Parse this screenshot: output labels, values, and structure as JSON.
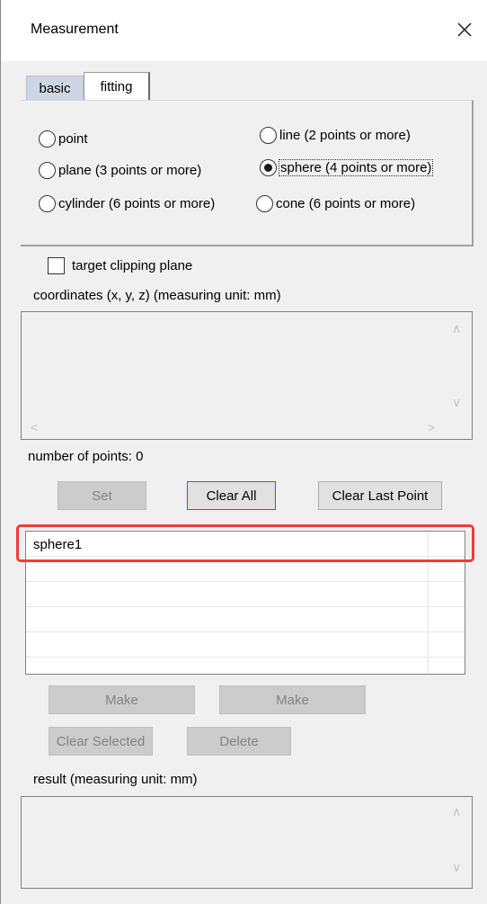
{
  "window": {
    "title": "Measurement",
    "close_glyph": "✕"
  },
  "tabs": [
    {
      "label": "basic",
      "active": false
    },
    {
      "label": "fitting",
      "active": true
    }
  ],
  "fitting": {
    "options": [
      {
        "label": "point",
        "checked": false
      },
      {
        "label": "line (2 points or more)",
        "checked": false
      },
      {
        "label": "plane (3 points or more)",
        "checked": false
      },
      {
        "label": "sphere (4 points or more)",
        "checked": true
      },
      {
        "label": "cylinder (6 points or more)",
        "checked": false
      },
      {
        "label": "cone (6 points or more)",
        "checked": false
      }
    ]
  },
  "target_clipping": {
    "label": "target clipping plane",
    "checked": false
  },
  "coordinates": {
    "label": "coordinates (x, y, z)   (measuring unit: mm)",
    "up_arrow": "∧",
    "down_arrow": "∨",
    "left_arrow": "<",
    "right_arrow": ">"
  },
  "points": {
    "label": "number of points: 0"
  },
  "buttons": {
    "set": "Set",
    "clear_all": "Clear All",
    "clear_last": "Clear Last Point",
    "make_1": "Make",
    "make_2": "Make",
    "clear_selected": "Clear Selected",
    "delete": "Delete"
  },
  "objects_list": {
    "rows": [
      "sphere1",
      "",
      "",
      "",
      ""
    ]
  },
  "result": {
    "label": "result   (measuring unit: mm)",
    "up_arrow": "∧",
    "down_arrow": "∨"
  },
  "colors": {
    "highlight": "#ee3b3b",
    "active_tab_bg": "#ffffff",
    "inactive_tab_bg": "#cdd6e2",
    "primary_border": "#0078d7"
  }
}
